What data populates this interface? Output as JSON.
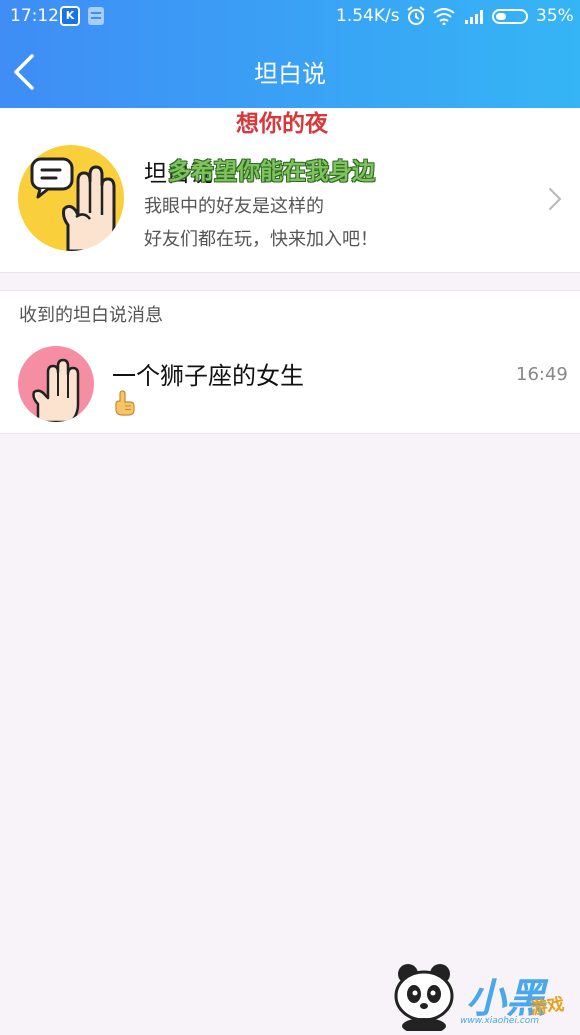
{
  "status_bar": {
    "time": "17:12",
    "network_speed": "1.54K/s",
    "battery_percent": "35%",
    "battery_level": 0.35,
    "icons": [
      "app-icon",
      "notification-icon",
      "alarm-icon",
      "wifi-icon",
      "signal-icon",
      "battery-icon"
    ]
  },
  "nav": {
    "title": "坦白说",
    "back_icon": "chevron-left-icon"
  },
  "feature": {
    "title": "坦白说",
    "desc1": "我眼中的好友是这样的",
    "desc2": "好友们都在玩，快来加入吧！",
    "icon": "hand-chat-icon"
  },
  "overlay": {
    "line1": "想你的夜",
    "line2": "多希望你能在我身边"
  },
  "section": {
    "title": "收到的坦白说消息"
  },
  "messages": [
    {
      "sender": "一个狮子座的女生",
      "time": "16:49",
      "preview_icon": "finger-up-emoji-icon"
    }
  ],
  "watermark": {
    "brand": "小黑",
    "sub": "游戏",
    "url": "www.xiaohei.com"
  },
  "colors": {
    "header_start": "#3f8df5",
    "header_end": "#35b5f5",
    "feature_avatar": "#f9cf3b",
    "message_avatar": "#f58ea2",
    "overlay_red": "#d9383a",
    "overlay_green": "#7fc35e"
  }
}
